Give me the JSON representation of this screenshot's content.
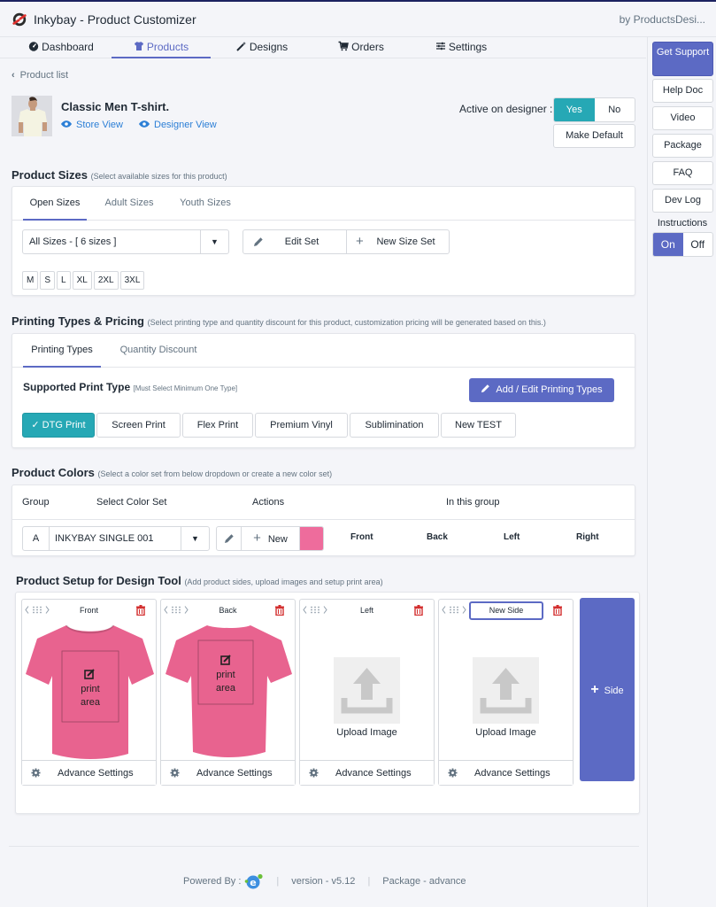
{
  "app": {
    "title": "Inkybay - Product Customizer",
    "by": "by ProductsDesi..."
  },
  "nav": {
    "items": [
      {
        "label": "Dashboard",
        "icon": "dashboard-icon",
        "active": false
      },
      {
        "label": "Products",
        "icon": "tshirt-icon",
        "active": true
      },
      {
        "label": "Designs",
        "icon": "magic-wand-icon",
        "active": false
      },
      {
        "label": "Orders",
        "icon": "cart-icon",
        "active": false
      },
      {
        "label": "Settings",
        "icon": "sliders-icon",
        "active": false
      }
    ]
  },
  "right_sidebar": {
    "get_support": "Get Support",
    "help_doc": "Help Doc",
    "video": "Video",
    "package": "Package",
    "faq": "FAQ",
    "dev_log": "Dev Log",
    "instructions_label": "Instructions",
    "instructions_on": "On",
    "instructions_off": "Off",
    "instructions_state": "On"
  },
  "product": {
    "back_label": "Product list",
    "name": "Classic Men T-shirt.",
    "store_view": "Store View",
    "designer_view": "Designer View",
    "active_label": "Active on designer :",
    "active_yes": "Yes",
    "active_no": "No",
    "active_state": "Yes",
    "make_default": "Make Default"
  },
  "sizes": {
    "title": "Product Sizes",
    "hint": "(Select available sizes for this product)",
    "tabs": [
      "Open Sizes",
      "Adult Sizes",
      "Youth Sizes"
    ],
    "active_tab": "Open Sizes",
    "selected_set": "All Sizes - [ 6 sizes ]",
    "edit_set": "Edit Set",
    "new_size_set": "New Size Set",
    "chips": [
      "M",
      "S",
      "L",
      "XL",
      "2XL",
      "3XL"
    ]
  },
  "printing": {
    "title": "Printing Types & Pricing",
    "hint": "(Select printing type and quantity discount for this product, customization pricing will be generated based on this.)",
    "tabs": [
      "Printing Types",
      "Quantity Discount"
    ],
    "active_tab": "Printing Types",
    "supported_title": "Supported Print Type",
    "supported_hint": "[Must Select Minimum One Type]",
    "add_edit": "Add / Edit Printing Types",
    "types": [
      {
        "label": "✓ DTG Print",
        "selected": true
      },
      {
        "label": "Screen Print",
        "selected": false
      },
      {
        "label": "Flex Print",
        "selected": false
      },
      {
        "label": "Premium Vinyl",
        "selected": false
      },
      {
        "label": "Sublimination",
        "selected": false
      },
      {
        "label": "New TEST",
        "selected": false
      }
    ]
  },
  "colors": {
    "title": "Product Colors",
    "hint": "(Select a color set from below dropdown or create a new color set)",
    "headers": {
      "group": "Group",
      "select": "Select Color Set",
      "actions": "Actions",
      "in_group": "In this group"
    },
    "row": {
      "group": "A",
      "color_set": "INKYBAY SINGLE 001",
      "new_label": "New",
      "swatch": "#ee6c9c",
      "sides": [
        "Front",
        "Back",
        "Left",
        "Right"
      ]
    }
  },
  "setup": {
    "title": "Product Setup for Design Tool",
    "hint": "(Add product sides, upload images and setup print area)",
    "sides": [
      {
        "name": "Front",
        "has_image": true,
        "print_area": "print area"
      },
      {
        "name": "Back",
        "has_image": true,
        "print_area": "print area"
      },
      {
        "name": "Left",
        "has_image": false,
        "upload": "Upload Image"
      },
      {
        "name": "New Side",
        "has_image": false,
        "upload": "Upload Image",
        "editing": true
      }
    ],
    "advance_settings": "Advance Settings",
    "add_side": "Side",
    "shirt_color": "#e8638f"
  },
  "footer": {
    "powered_by": "Powered By :",
    "version": "version - v5.12",
    "package": "Package - advance"
  }
}
